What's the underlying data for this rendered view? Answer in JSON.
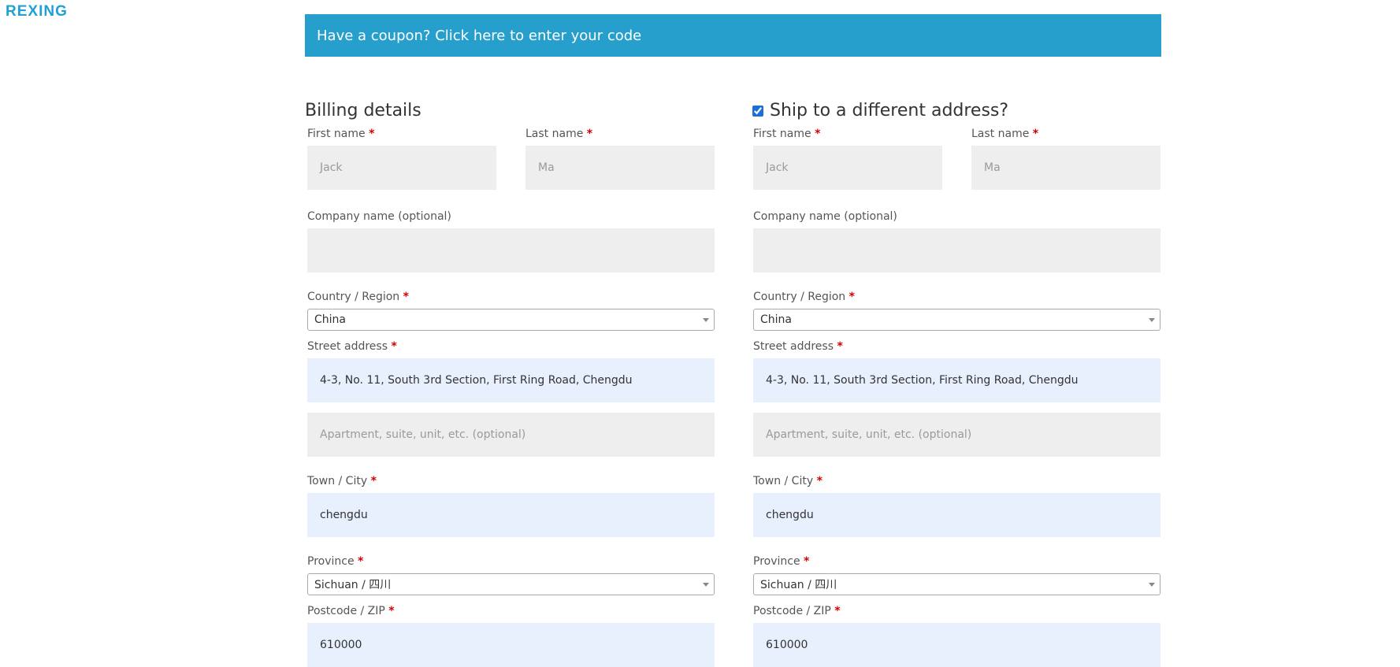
{
  "logo": "REXING",
  "coupon": {
    "text": "Have a coupon? Click here to enter your code"
  },
  "billing": {
    "heading": "Billing details",
    "first_name": {
      "label": "First name",
      "value": "Jack"
    },
    "last_name": {
      "label": "Last name",
      "value": "Ma"
    },
    "company": {
      "label": "Company name (optional)",
      "value": ""
    },
    "country": {
      "label": "Country / Region",
      "value": "China"
    },
    "street": {
      "label": "Street address",
      "value": "4-3, No. 11, South 3rd Section, First Ring Road, Chengdu"
    },
    "apartment": {
      "placeholder": "Apartment, suite, unit, etc. (optional)"
    },
    "city": {
      "label": "Town / City",
      "value": "chengdu"
    },
    "province": {
      "label": "Province",
      "value": "Sichuan / 四川"
    },
    "postcode": {
      "label": "Postcode / ZIP",
      "value": "610000"
    }
  },
  "shipping": {
    "heading": "Ship to a different address?",
    "checked": true,
    "first_name": {
      "label": "First name",
      "value": "Jack"
    },
    "last_name": {
      "label": "Last name",
      "value": "Ma"
    },
    "company": {
      "label": "Company name (optional)",
      "value": ""
    },
    "country": {
      "label": "Country / Region",
      "value": "China"
    },
    "street": {
      "label": "Street address",
      "value": "4-3, No. 11, South 3rd Section, First Ring Road, Chengdu"
    },
    "apartment": {
      "placeholder": "Apartment, suite, unit, etc. (optional)"
    },
    "city": {
      "label": "Town / City",
      "value": "chengdu"
    },
    "province": {
      "label": "Province",
      "value": "Sichuan / 四川"
    },
    "postcode": {
      "label": "Postcode / ZIP",
      "value": "610000"
    }
  },
  "required_marker": "*",
  "colors": {
    "coupon_bg": "#279fcd",
    "logo": "#1fa1d6",
    "required": "#d20000",
    "autofill_bg": "#e8f0fe",
    "field_bg": "#eeeeee"
  }
}
